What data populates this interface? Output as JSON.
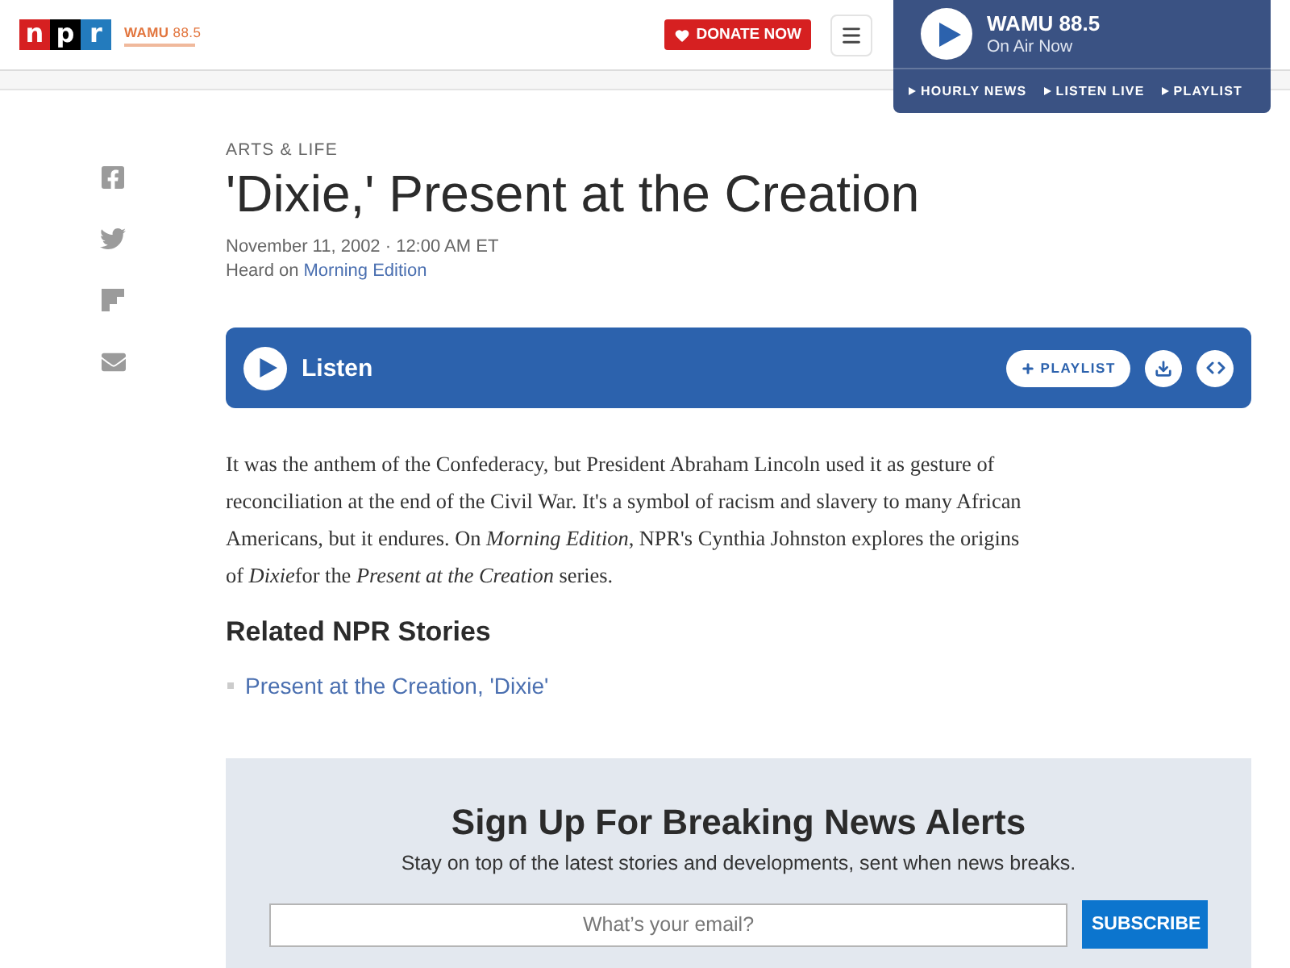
{
  "header": {
    "logo": {
      "letters": [
        "n",
        "p",
        "r"
      ]
    },
    "station_logo": "**WAMU** 88.5",
    "donate_button": "DONATE NOW",
    "player": {
      "station": "WAMU 88.5",
      "status": "On Air Now",
      "links": [
        "HOURLY NEWS",
        "LISTEN LIVE",
        "PLAYLIST"
      ]
    }
  },
  "article": {
    "section": "ARTS & LIFE",
    "title": "'Dixie,' Present at the Creation",
    "date": "November 11, 2002 · 12:00 AM ET",
    "heard_on": {
      "label": "Heard on",
      "program": "Morning Edition"
    },
    "audio": {
      "label": "Listen",
      "playlist_button": "PLAYLIST"
    },
    "body": {
      "segments": [
        {
          "text": "It was the anthem of the Confederacy, but President Abraham Lincoln used it as gesture of reconciliation at the end of the Civil War. It's a symbol of racism and slavery to many African Americans, but it endures. On ",
          "italic": false
        },
        {
          "text": "Morning Edition",
          "italic": true
        },
        {
          "text": ", NPR's Cynthia Johnston explores the origins of ",
          "italic": false
        },
        {
          "text": "Dixie",
          "italic": true
        },
        {
          "text": "for the ",
          "italic": false
        },
        {
          "text": "Present at the Creation",
          "italic": true
        },
        {
          "text": " series.",
          "italic": false
        }
      ]
    },
    "related": {
      "heading": "Related NPR Stories",
      "links": [
        "Present at the Creation, 'Dixie'"
      ]
    }
  },
  "newsletter": {
    "heading": "Sign Up For Breaking News Alerts",
    "description": "Stay on top of the latest stories and developments, sent when news breaks.",
    "email": {
      "placeholder": "What’s your email?"
    },
    "button": "SUBSCRIBE"
  }
}
